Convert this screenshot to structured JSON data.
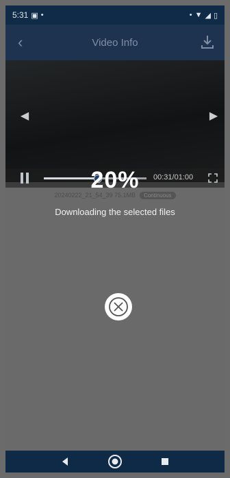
{
  "status_bar": {
    "time": "5:31",
    "notification_icon": "image-notification-icon",
    "dot": "•",
    "right_dot": "•",
    "wifi_icon": "wifi-icon",
    "signal_icon": "signal-icon",
    "battery_icon": "battery-icon"
  },
  "header": {
    "title": "Video Info",
    "back_icon": "chevron-left-icon",
    "download_icon": "download-icon"
  },
  "player": {
    "prev_icon": "triangle-left-icon",
    "next_icon": "triangle-right-icon",
    "pause_icon": "pause-icon",
    "progress_fraction": 0.52,
    "time": "00:31/01:00",
    "fullscreen_icon": "fullscreen-icon"
  },
  "file_info": {
    "name_size": "20240222_21_54_39 75.1MB",
    "badge": "Continuous"
  },
  "download": {
    "percent": "20%",
    "message": "Downloading the selected files",
    "cancel_icon": "close-circle-icon"
  },
  "nav_bar": {
    "back_icon": "nav-back-icon",
    "home_icon": "nav-home-icon",
    "recents_icon": "nav-recents-icon"
  },
  "colors": {
    "status_bar": "#102b47",
    "header": "#1e3350",
    "overlay": "#6a6a6a"
  }
}
